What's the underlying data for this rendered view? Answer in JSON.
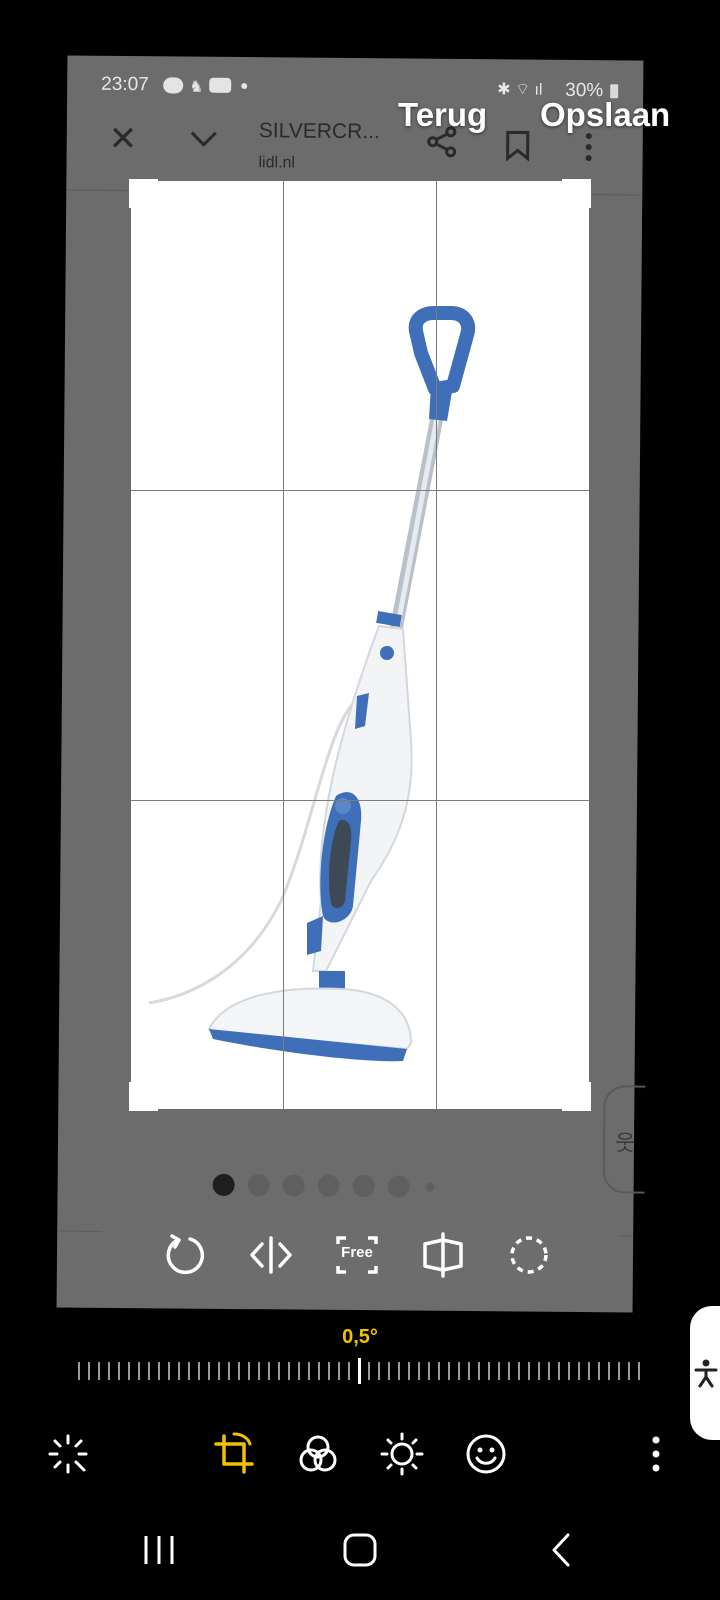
{
  "editor": {
    "back_label": "Terug",
    "save_label": "Opslaan",
    "angle": "0,5°",
    "tools": [
      "auto-adjust-icon",
      "transform-icon",
      "filters-icon",
      "brightness-icon",
      "sticker-icon",
      "more-icon"
    ],
    "active_tool": "transform-icon",
    "accent": "#f2c200"
  },
  "inner_screen": {
    "status": {
      "time": "23:07",
      "battery": "30%"
    },
    "site_title": "SILVERCR...",
    "site_domain": "lidl.nl",
    "crop_buttons": {
      "free_label": "Free"
    }
  }
}
